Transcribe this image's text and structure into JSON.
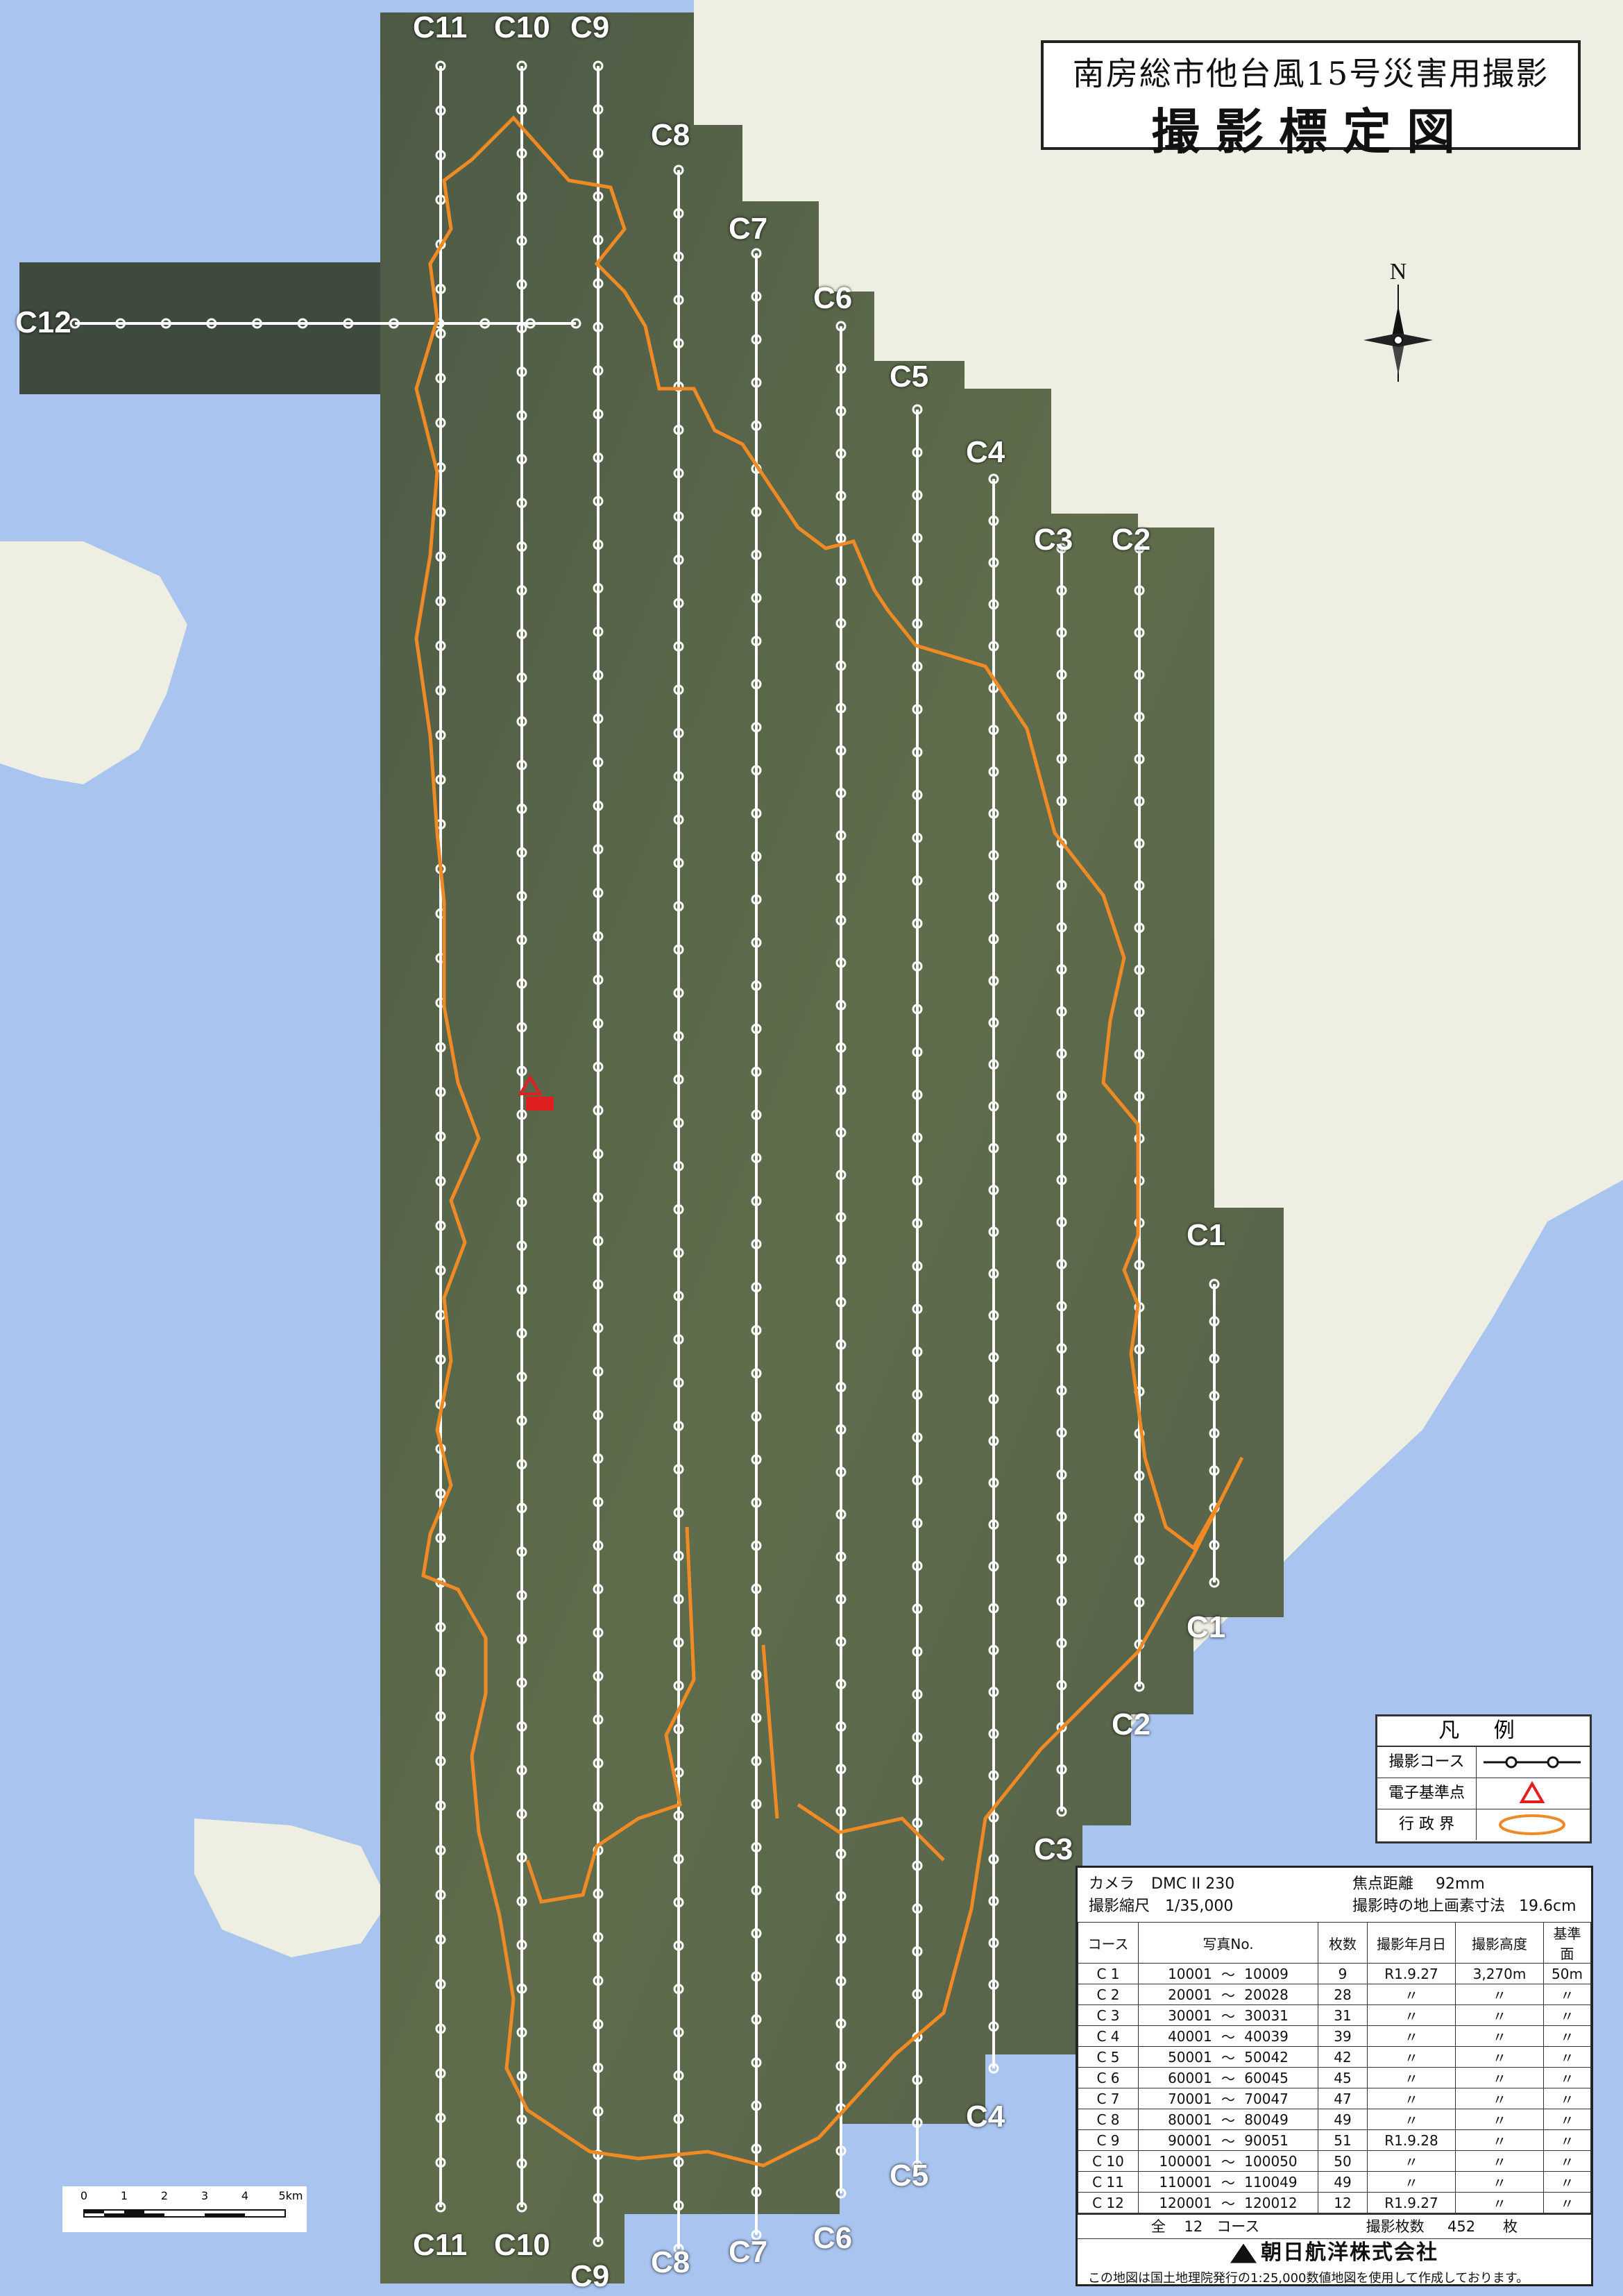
{
  "title": {
    "line1": "南房総市他台風15号災害用撮影",
    "line2": "撮影標定図"
  },
  "north_label": "N",
  "courses": [
    {
      "label": "C1",
      "top_label": "C1",
      "bottom_label": "C1",
      "first": "10001",
      "last": "10009"
    },
    {
      "label": "C2",
      "top_label": "C2",
      "bottom_label": "C2",
      "first": "20001",
      "last": "20028"
    },
    {
      "label": "C3",
      "top_label": "C3",
      "bottom_label": "C3",
      "first": "30001",
      "last": "30031"
    },
    {
      "label": "C4",
      "top_label": "C4",
      "bottom_label": "C4",
      "first": "40001",
      "last": "40039"
    },
    {
      "label": "C5",
      "top_label": "C5",
      "bottom_label": "C5",
      "first": "50001",
      "last": "50042"
    },
    {
      "label": "C6",
      "top_label": "C6",
      "bottom_label": "C6",
      "first": "60001",
      "last": "60045"
    },
    {
      "label": "C7",
      "top_label": "C7",
      "bottom_label": "C7",
      "first": "70001",
      "last": "70047"
    },
    {
      "label": "C8",
      "top_label": "C8",
      "bottom_label": "C8",
      "first": "80001",
      "last": "80049"
    },
    {
      "label": "C9",
      "top_label": "C9",
      "bottom_label": "C9",
      "first": "90001",
      "last": "90051"
    },
    {
      "label": "C10",
      "top_label": "C10",
      "bottom_label": "C10",
      "first": "100001",
      "last": "100050"
    },
    {
      "label": "C11",
      "top_label": "C11",
      "bottom_label": "C11",
      "first": "110001",
      "last": "110049"
    },
    {
      "label": "C12",
      "top_label": "C12",
      "bottom_label": "",
      "first": "120001",
      "last": "120012"
    }
  ],
  "legend": {
    "title": "凡 例",
    "rows": [
      {
        "label": "撮影コース",
        "symbol": "course-line"
      },
      {
        "label": "電子基準点",
        "symbol": "triangle"
      },
      {
        "label": "行 政 界",
        "symbol": "boundary"
      }
    ],
    "colors": {
      "boundary": "#f08a24",
      "reference_point": "#e02020",
      "course": "#ffffff"
    }
  },
  "info": {
    "camera_label": "カメラ",
    "camera": "DMC II 230",
    "focal_label": "焦点距離",
    "focal": "92mm",
    "scale_label": "撮影縮尺",
    "scale": "1/35,000",
    "gsd_label": "撮影時の地上画素寸法",
    "gsd": "19.6cm",
    "columns": [
      "コース",
      "写真No.",
      "",
      "枚数",
      "撮影年月日",
      "撮影高度",
      "基準面"
    ],
    "rows": [
      {
        "course": "C 1",
        "from": "10001",
        "sep": "～",
        "to": "10009",
        "count": "9",
        "date": "R1.9.27",
        "alt": "3,270m",
        "datum": "50m"
      },
      {
        "course": "C 2",
        "from": "20001",
        "sep": "～",
        "to": "20028",
        "count": "28",
        "date": "〃",
        "alt": "〃",
        "datum": "〃"
      },
      {
        "course": "C 3",
        "from": "30001",
        "sep": "～",
        "to": "30031",
        "count": "31",
        "date": "〃",
        "alt": "〃",
        "datum": "〃"
      },
      {
        "course": "C 4",
        "from": "40001",
        "sep": "～",
        "to": "40039",
        "count": "39",
        "date": "〃",
        "alt": "〃",
        "datum": "〃"
      },
      {
        "course": "C 5",
        "from": "50001",
        "sep": "～",
        "to": "50042",
        "count": "42",
        "date": "〃",
        "alt": "〃",
        "datum": "〃"
      },
      {
        "course": "C 6",
        "from": "60001",
        "sep": "～",
        "to": "60045",
        "count": "45",
        "date": "〃",
        "alt": "〃",
        "datum": "〃"
      },
      {
        "course": "C 7",
        "from": "70001",
        "sep": "～",
        "to": "70047",
        "count": "47",
        "date": "〃",
        "alt": "〃",
        "datum": "〃"
      },
      {
        "course": "C 8",
        "from": "80001",
        "sep": "～",
        "to": "80049",
        "count": "49",
        "date": "〃",
        "alt": "〃",
        "datum": "〃"
      },
      {
        "course": "C 9",
        "from": "90001",
        "sep": "～",
        "to": "90051",
        "count": "51",
        "date": "R1.9.28",
        "alt": "〃",
        "datum": "〃"
      },
      {
        "course": "C 10",
        "from": "100001",
        "sep": "～",
        "to": "100050",
        "count": "50",
        "date": "〃",
        "alt": "〃",
        "datum": "〃"
      },
      {
        "course": "C 11",
        "from": "110001",
        "sep": "～",
        "to": "110049",
        "count": "49",
        "date": "〃",
        "alt": "〃",
        "datum": "〃"
      },
      {
        "course": "C 12",
        "from": "120001",
        "sep": "～",
        "to": "120012",
        "count": "12",
        "date": "R1.9.27",
        "alt": "〃",
        "datum": "〃"
      }
    ],
    "total_label": "全",
    "total_courses": "12",
    "total_courses_unit": "コース",
    "total_photos_label": "撮影枚数",
    "total_photos": "452",
    "total_photos_unit": "枚",
    "company": "朝日航洋株式会社"
  },
  "note": "この地図は国土地理院発行の1:25,000数値地図を使用して作成しております。",
  "scale_bar": {
    "ticks": [
      "0",
      "1",
      "2",
      "3",
      "4",
      "5km"
    ]
  }
}
